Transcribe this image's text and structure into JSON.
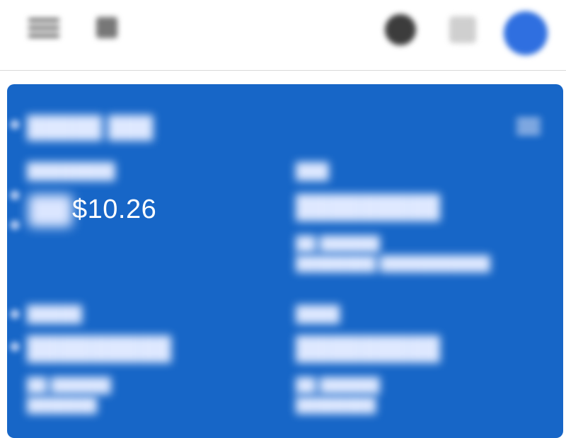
{
  "header": {
    "menu_icon": "hamburger-menu-icon",
    "apps_icon": "apps-grid-icon",
    "help_icon": "help-icon",
    "add_icon": "add-icon",
    "avatar_icon": "account-avatar-icon"
  },
  "card": {
    "balance": "$10.26",
    "colors": {
      "card_background": "#1766c7",
      "balance_text": "#ffffff"
    }
  }
}
